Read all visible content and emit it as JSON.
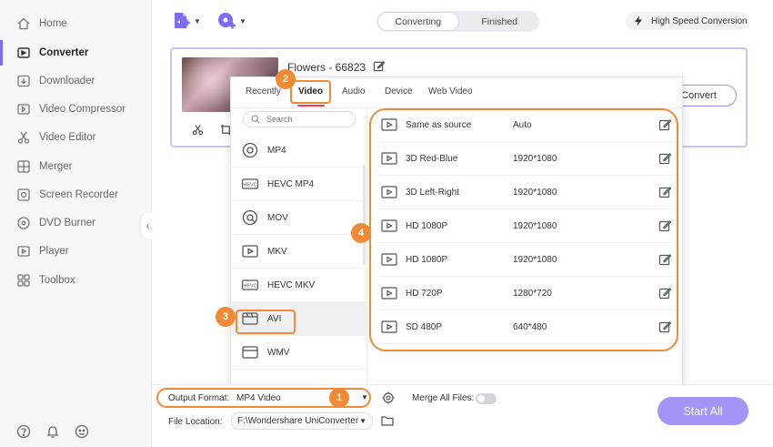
{
  "sidebar": {
    "items": [
      {
        "label": "Home",
        "icon": "home-icon"
      },
      {
        "label": "Converter",
        "icon": "converter-icon"
      },
      {
        "label": "Downloader",
        "icon": "downloader-icon"
      },
      {
        "label": "Video Compressor",
        "icon": "compress-icon"
      },
      {
        "label": "Video Editor",
        "icon": "scissors-icon"
      },
      {
        "label": "Merger",
        "icon": "merger-icon"
      },
      {
        "label": "Screen Recorder",
        "icon": "screen-recorder-icon"
      },
      {
        "label": "DVD Burner",
        "icon": "disc-icon"
      },
      {
        "label": "Player",
        "icon": "player-icon"
      },
      {
        "label": "Toolbox",
        "icon": "toolbox-icon"
      }
    ],
    "active": "Converter"
  },
  "toolbar": {
    "tabs": [
      "Converting",
      "Finished"
    ],
    "active_tab": "Converting",
    "high_speed": "High Speed Conversion"
  },
  "file": {
    "title": "Flowers - 66823",
    "convert_label": "Convert"
  },
  "format_panel": {
    "tabs": [
      "Recently",
      "Video",
      "Audio",
      "Device",
      "Web Video"
    ],
    "active_tab": "Video",
    "search_placeholder": "Search",
    "formats": [
      "MP4",
      "HEVC MP4",
      "MOV",
      "MKV",
      "HEVC MKV",
      "AVI",
      "WMV"
    ],
    "selected_format": "AVI",
    "resolutions": [
      {
        "name": "Same as source",
        "res": "Auto"
      },
      {
        "name": "3D Red-Blue",
        "res": "1920*1080"
      },
      {
        "name": "3D Left-Right",
        "res": "1920*1080"
      },
      {
        "name": "HD 1080P",
        "res": "1920*1080"
      },
      {
        "name": "HD 1080P",
        "res": "1920*1080"
      },
      {
        "name": "HD 720P",
        "res": "1280*720"
      },
      {
        "name": "SD 480P",
        "res": "640*480"
      }
    ]
  },
  "badges": {
    "b1": "1",
    "b2": "2",
    "b3": "3",
    "b4": "4"
  },
  "bottom": {
    "output_format_label": "Output Format:",
    "output_format_value": "MP4 Video",
    "merge_label": "Merge All Files:",
    "file_location_label": "File Location:",
    "file_location_value": "F:\\Wondershare UniConverter",
    "start_all": "Start All"
  },
  "colors": {
    "accent": "#7d6df6",
    "highlight": "#f08a35",
    "start_all": "#a395f7"
  }
}
